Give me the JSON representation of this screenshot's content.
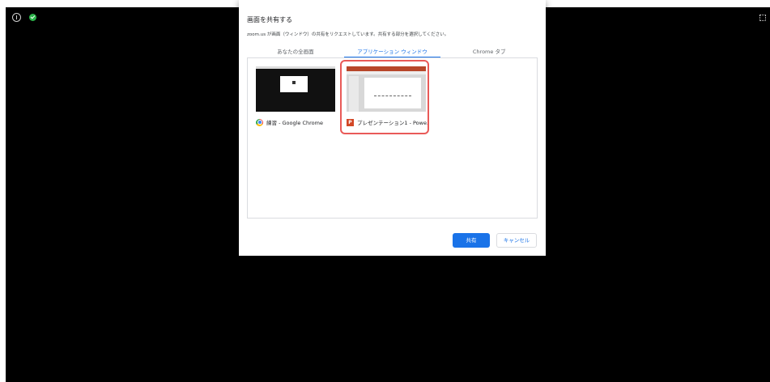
{
  "dialog": {
    "title": "画面を共有する",
    "subtitle": "zoom.us が画面（ウィンドウ）の共有をリクエストしています。共有する部分を選択してください。",
    "tabs": [
      {
        "label": "あなたの全画面",
        "active": false
      },
      {
        "label": "アプリケーション ウィンドウ",
        "active": true
      },
      {
        "label": "Chrome タブ",
        "active": false
      }
    ],
    "windows": [
      {
        "label": "練習 - Google Chrome",
        "icon": "chrome-icon",
        "selected": false
      },
      {
        "label": "プレゼンテーション1 - Powe...",
        "icon": "powerpoint-icon",
        "icon_letter": "P",
        "selected": true
      }
    ],
    "share_label": "共有",
    "cancel_label": "キャンセル"
  },
  "colors": {
    "accent": "#1a73e8",
    "selection": "#e95a58",
    "background": "#000000"
  }
}
